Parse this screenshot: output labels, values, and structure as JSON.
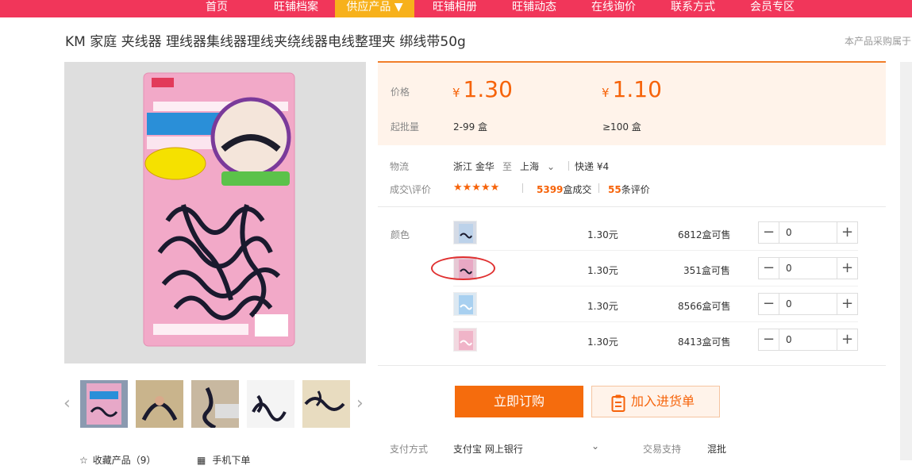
{
  "nav": [
    "首页",
    "旺铺档案",
    "供应产品 ▼",
    "旺铺相册",
    "旺铺动态",
    "在线询价",
    "联系方式",
    "会员专区"
  ],
  "product_title": "KM 家庭 夹线器 理线器集线器理线夹绕线器电线整理夹 绑线带50g",
  "side_note": "本产品采购属于",
  "price": {
    "label": "价格",
    "currency": "¥",
    "tier1_price": "1.30",
    "tier2_price": "1.10",
    "moq_label": "起批量",
    "tier1_qty": "2-99 盒",
    "tier2_qty": "≥100 盒"
  },
  "logistics": {
    "label": "物流",
    "from": "浙江 金华",
    "to_word": "至",
    "to": "上海",
    "shipping": "快递 ¥4"
  },
  "deals": {
    "label": "成交\\评价",
    "stars": "★★★★★",
    "sold_count": "5399",
    "sold_suffix": "盒成交",
    "review_count": "55",
    "review_suffix": "条评价"
  },
  "sku": {
    "label": "颜色",
    "rows": [
      {
        "price": "1.30元",
        "stock_num": "6812",
        "stock_suffix": "盒可售",
        "qty": "0"
      },
      {
        "price": "1.30元",
        "stock_num": "351",
        "stock_suffix": "盒可售",
        "qty": "0"
      },
      {
        "price": "1.30元",
        "stock_num": "8566",
        "stock_suffix": "盒可售",
        "qty": "0"
      },
      {
        "price": "1.30元",
        "stock_num": "8413",
        "stock_suffix": "盒可售",
        "qty": "0"
      }
    ]
  },
  "buttons": {
    "buy": "立即订购",
    "add_cart": "加入进货单"
  },
  "payment": {
    "label": "支付方式",
    "methods": "支付宝 网上银行",
    "support_label": "交易支持",
    "support_value": "混批"
  },
  "gallery": {
    "favorite": "收藏产品（9）",
    "mobile_order": "手机下单"
  },
  "colors": {
    "nav_bg": "#f1365a",
    "nav_active": "#f7b11b",
    "accent": "#f6630a",
    "price_bg": "#fff3ea"
  }
}
